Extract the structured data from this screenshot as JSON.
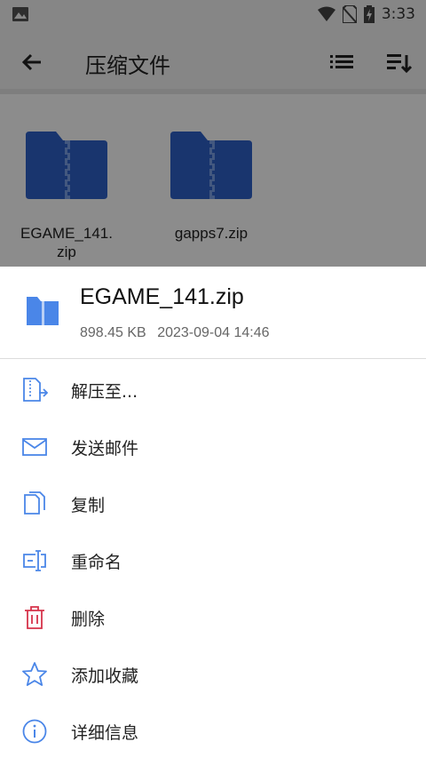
{
  "status_bar": {
    "time": "3:33"
  },
  "toolbar": {
    "title": "压缩文件"
  },
  "files": [
    {
      "name_line1": "EGAME_141.",
      "name_line2": "zip"
    },
    {
      "name_line1": "gapps7.zip",
      "name_line2": ""
    }
  ],
  "sheet": {
    "file_name": "EGAME_141.zip",
    "size": "898.45 KB",
    "date": "2023-09-04 14:46"
  },
  "menu": [
    {
      "label": "解压至...",
      "icon": "extract-icon"
    },
    {
      "label": "发送邮件",
      "icon": "mail-icon"
    },
    {
      "label": "复制",
      "icon": "copy-icon"
    },
    {
      "label": "重命名",
      "icon": "rename-icon"
    },
    {
      "label": "删除",
      "icon": "trash-icon"
    },
    {
      "label": "添加收藏",
      "icon": "star-icon"
    },
    {
      "label": "详细信息",
      "icon": "info-icon"
    }
  ],
  "colors": {
    "accent": "#4a86e8",
    "delete": "#d6334a",
    "folder": "#2f62c9"
  }
}
